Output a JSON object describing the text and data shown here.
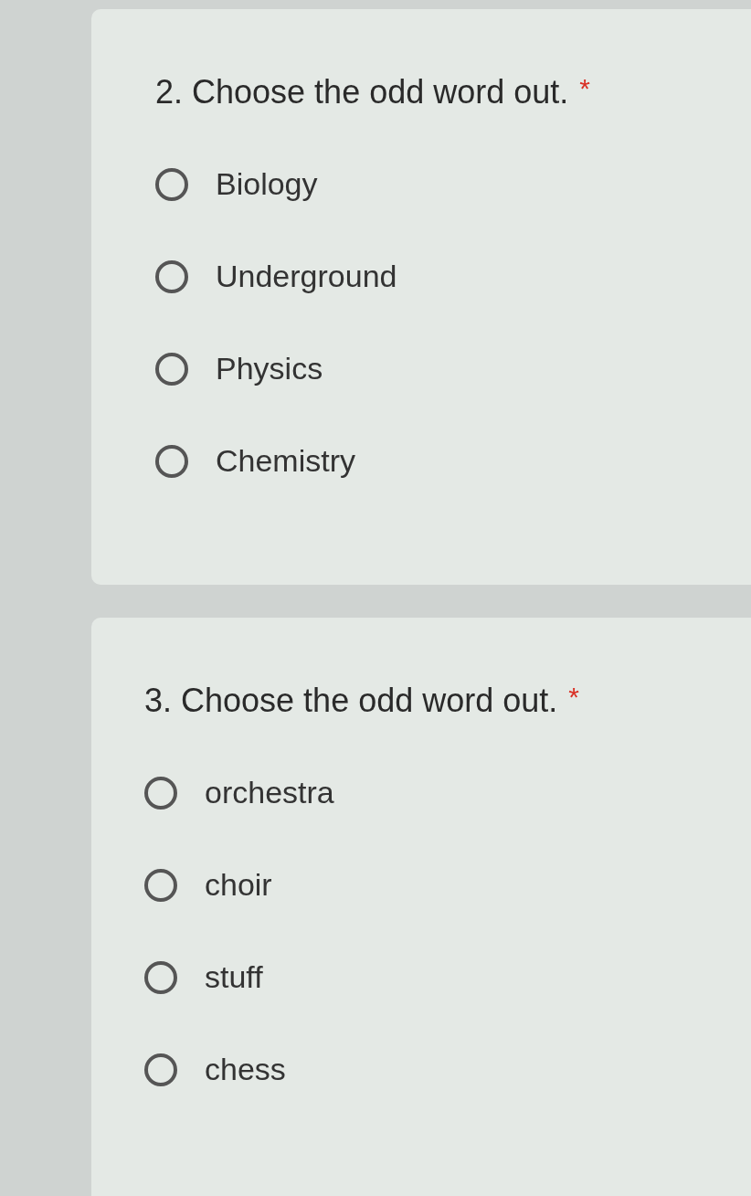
{
  "questions": [
    {
      "title": "2. Choose the odd word out.",
      "required_mark": "*",
      "options": [
        {
          "label": "Biology",
          "selected": false
        },
        {
          "label": "Underground",
          "selected": false
        },
        {
          "label": "Physics",
          "selected": false
        },
        {
          "label": "Chemistry",
          "selected": false
        }
      ]
    },
    {
      "title": "3. Choose the odd word out.",
      "required_mark": "*",
      "options": [
        {
          "label": "orchestra",
          "selected": false
        },
        {
          "label": "choir",
          "selected": false
        },
        {
          "label": "stuff",
          "selected": false
        },
        {
          "label": "chess",
          "selected": false
        }
      ]
    }
  ]
}
